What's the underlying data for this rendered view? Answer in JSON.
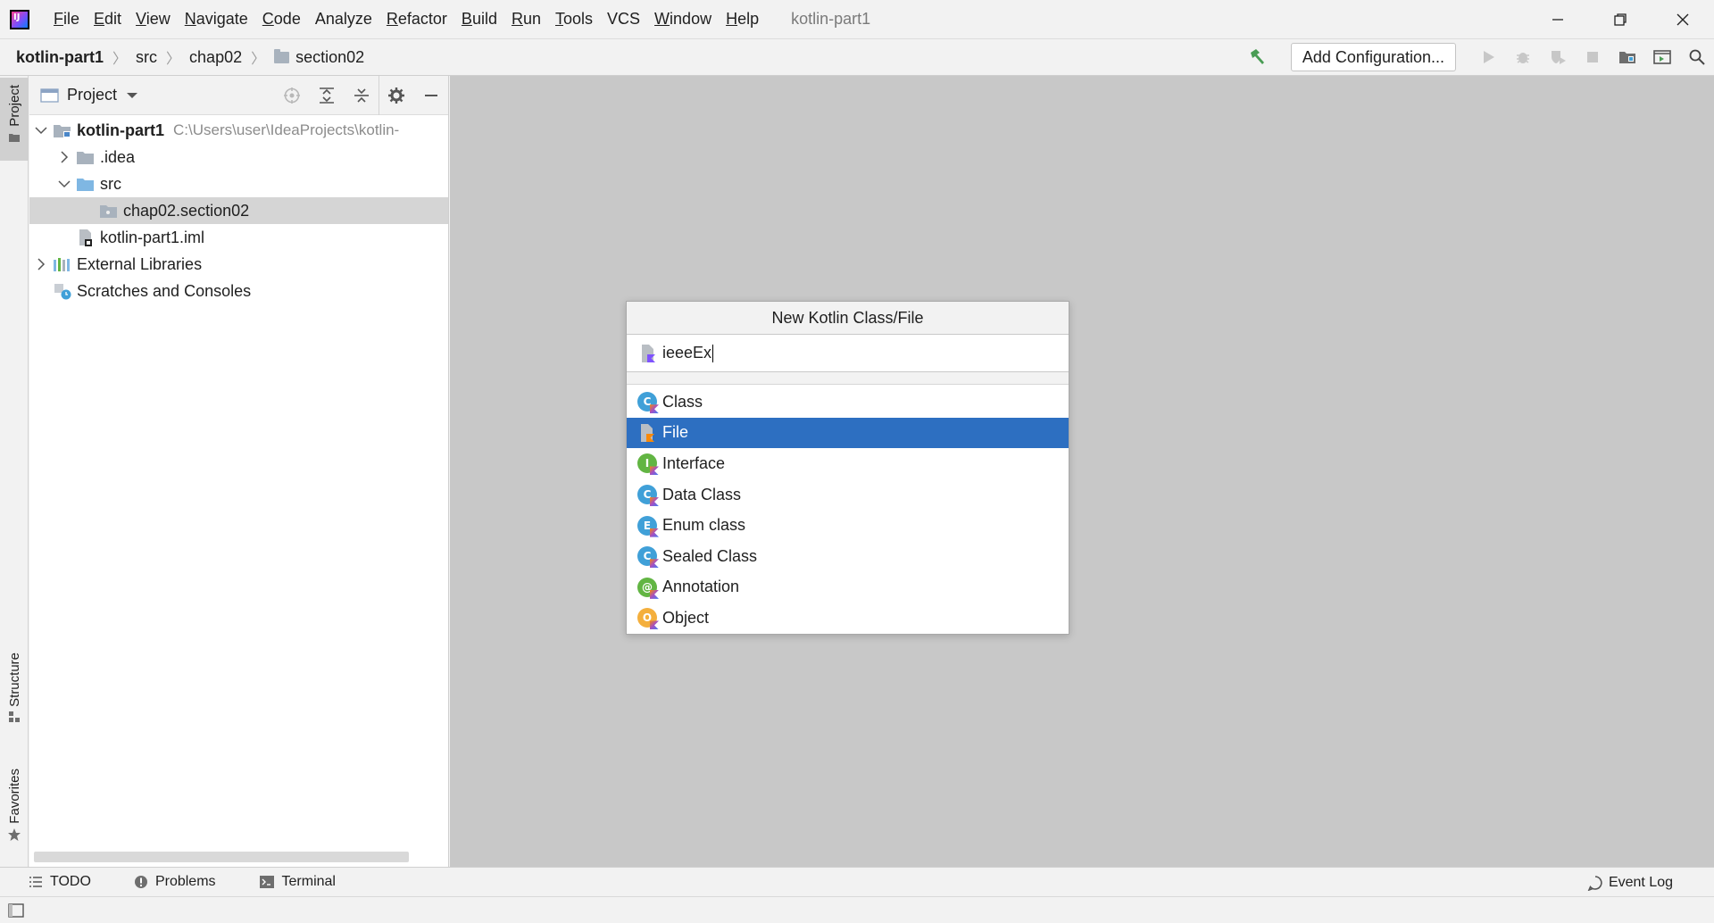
{
  "window": {
    "title": "kotlin-part1",
    "menu": [
      "File",
      "Edit",
      "View",
      "Navigate",
      "Code",
      "Analyze",
      "Refactor",
      "Build",
      "Run",
      "Tools",
      "VCS",
      "Window",
      "Help"
    ],
    "mnemonic_first_letter": [
      "F",
      "E",
      "V",
      "N",
      "C",
      "",
      "R",
      "B",
      "R",
      "T",
      "",
      "W",
      "H"
    ]
  },
  "breadcrumb": [
    "kotlin-part1",
    "src",
    "chap02",
    "section02"
  ],
  "toolbar": {
    "add_config_label": "Add Configuration...",
    "accent_green": "#499c54"
  },
  "side_tabs": {
    "project": "Project",
    "structure": "Structure",
    "favorites": "Favorites"
  },
  "project_panel": {
    "title": "Project",
    "tree": [
      {
        "label": "kotlin-part1",
        "hint": "C:\\Users\\user\\IdeaProjects\\kotlin-",
        "expanded": true,
        "icon": "module-folder-icon"
      },
      {
        "label": ".idea",
        "expanded": false,
        "icon": "folder-icon"
      },
      {
        "label": "src",
        "expanded": true,
        "icon": "source-folder-icon"
      },
      {
        "label": "chap02.section02",
        "selected": true,
        "icon": "package-icon"
      },
      {
        "label": "kotlin-part1.iml",
        "icon": "iml-file-icon"
      },
      {
        "label": "External Libraries",
        "expanded": false,
        "icon": "libraries-icon"
      },
      {
        "label": "Scratches and Consoles",
        "icon": "scratches-icon"
      }
    ]
  },
  "dialog": {
    "title": "New Kotlin Class/File",
    "input_value": "ieeeEx",
    "kinds": [
      {
        "label": "Class",
        "icon": "kotlin-class-icon",
        "letter": "C",
        "color": "#40a0d8"
      },
      {
        "label": "File",
        "icon": "kotlin-file-icon",
        "selected": true
      },
      {
        "label": "Interface",
        "icon": "kotlin-interface-icon",
        "letter": "I",
        "color": "#62b543"
      },
      {
        "label": "Data Class",
        "icon": "kotlin-data-class-icon",
        "letter": "C",
        "color": "#40a0d8"
      },
      {
        "label": "Enum class",
        "icon": "kotlin-enum-icon",
        "letter": "E",
        "color": "#40a0d8"
      },
      {
        "label": "Sealed Class",
        "icon": "kotlin-sealed-class-icon",
        "letter": "C",
        "color": "#40a0d8"
      },
      {
        "label": "Annotation",
        "icon": "kotlin-annotation-icon",
        "letter": "@",
        "color": "#62b543"
      },
      {
        "label": "Object",
        "icon": "kotlin-object-icon",
        "letter": "O",
        "color": "#f4af3d"
      }
    ],
    "selected_color": "#2d6fc1"
  },
  "bottom_tabs": {
    "todo": "TODO",
    "problems": "Problems",
    "terminal": "Terminal",
    "event_log": "Event Log"
  }
}
